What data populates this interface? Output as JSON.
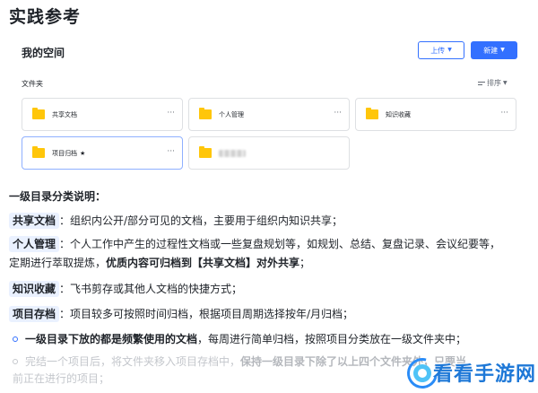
{
  "page_title": "实践参考",
  "space": {
    "title": "我的空间",
    "upload_label": "上传",
    "new_label": "新建"
  },
  "folders": {
    "label": "文件夹",
    "sort_label": "排序",
    "items": [
      {
        "name": "共享文档",
        "starred": false,
        "selected": false,
        "blurred": false
      },
      {
        "name": "个人管理",
        "starred": false,
        "selected": false,
        "blurred": false
      },
      {
        "name": "知识收藏",
        "starred": false,
        "selected": false,
        "blurred": false
      },
      {
        "name": "项目归档",
        "starred": true,
        "selected": true,
        "blurred": false
      },
      {
        "name": "",
        "starred": false,
        "selected": false,
        "blurred": true
      }
    ],
    "star_glyph": "★",
    "more_glyph": "···"
  },
  "doc": {
    "heading": "一级目录分类说明：",
    "items": [
      {
        "tag": "共享文档",
        "text": "：组织内公开/部分可见的文档，主要用于组织内知识共享；"
      },
      {
        "tag": "个人管理",
        "text": "：个人工作中产生的过程性文档或一些复盘规划等，如规划、总结、复盘记录、会议纪要等，定期进行萃取提炼，",
        "bold_tail": "优质内容可归档到【共享文档】对外共享",
        "tail": "；"
      },
      {
        "tag": "知识收藏",
        "text": "：飞书剪存或其他人文档的快捷方式；"
      },
      {
        "tag": "项目存档",
        "text": "：项目较多可按照时间归档，根据项目周期选择按年/月归档；"
      }
    ],
    "bullets": [
      {
        "bold": "一级目录下放的都是频繁使用的文档",
        "text": "，每周进行简单归档，按照项目分类放在一级文件夹中；"
      },
      {
        "text": "完结一个项目后，将文件夹移入项目存档中，",
        "bold": "保持一级目录下除了以上四个文件夹外，只要当",
        "cont": "前正在进行的项目；"
      }
    ]
  },
  "watermark": {
    "text": "看看手游网"
  },
  "colors": {
    "accent": "#3370ff",
    "folder": "#ffc60a",
    "tag_bg": "#eaf1ff"
  }
}
